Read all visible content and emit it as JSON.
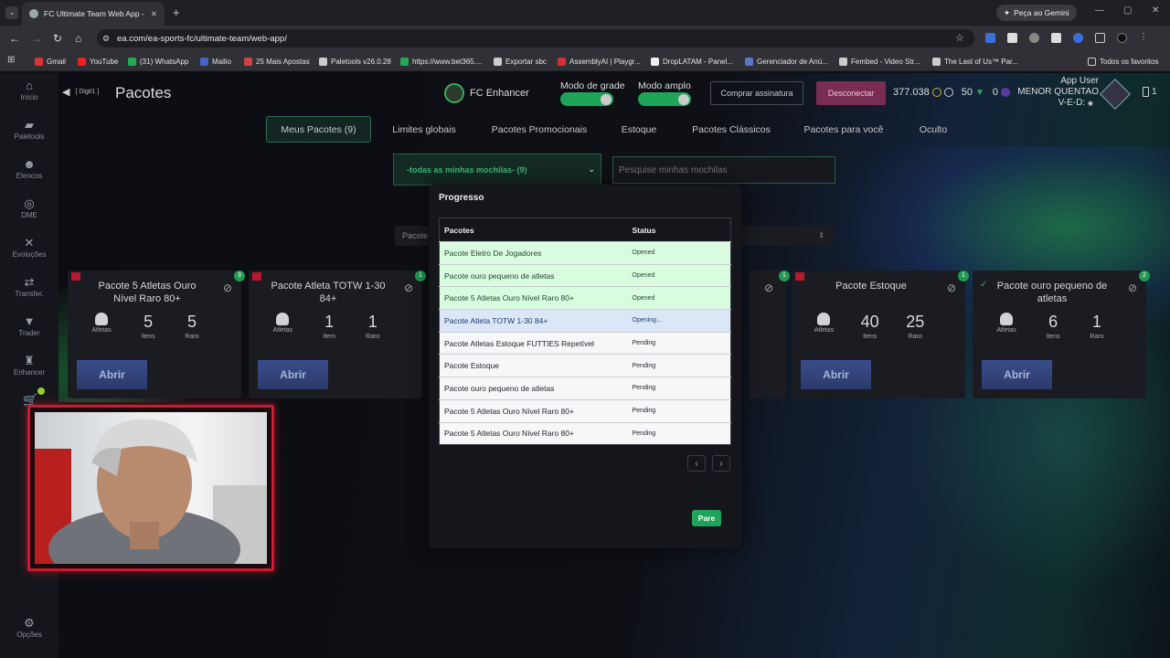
{
  "browser": {
    "tab_title": "FC Ultimate Team Web App - E...",
    "gemini_label": "Peça ao Gemini",
    "url": "ea.com/ea-sports-fc/ultimate-team/web-app/",
    "bookmarks": [
      "Gmail",
      "YouTube",
      "(31) WhatsApp",
      "Mailio",
      "25 Mais Apostas",
      "Paletools v26.0.28",
      "https://www.bet365....",
      "Exportar sbc",
      "AssemblyAI | Playgr...",
      "DropLATAM - Panel...",
      "Gerenciador de Anú...",
      "Fembed - Video Str...",
      "The Last of Us™ Par..."
    ],
    "all_favorites": "Todos os favoritos"
  },
  "sidebar": [
    "Início",
    "Paletools",
    "Elencos",
    "DME",
    "Evoluções",
    "Transfer.",
    "Trader",
    "Enhancer",
    "Opções"
  ],
  "header": {
    "back_label": "[ Digit1 ]",
    "title": "Pacotes",
    "enhancer": "FC Enhancer",
    "grid_mode": "Modo de grade",
    "wide_mode": "Modo amplo",
    "buy_subscription": "Comprar assinatura",
    "disconnect": "Desconectar",
    "coins": "377.038",
    "points": "50",
    "other": "0",
    "user_app": "App User",
    "user_name": "MENOR QUENTAO",
    "user_ved": "V-E-D:",
    "notifications": "1"
  },
  "tabs": [
    "Meus Pacotes (9)",
    "Limites globais",
    "Pacotes Promocionais",
    "Estoque",
    "Pacotes Clássicos",
    "Pacotes para você",
    "Oculto"
  ],
  "filter": {
    "select_value": "-todas as minhas mochilas- (9)",
    "search_placeholder": "Pesquise minhas mochilas",
    "sort_label": "Pacote"
  },
  "cards": [
    {
      "title": "Pacote 5 Atletas Ouro Nível Raro 80+",
      "badge": "3",
      "atletas": "5",
      "itens": "5",
      "raro": "",
      "l1": "Atletas",
      "l2": "Itens",
      "l3": "Raro",
      "open": "Abrir"
    },
    {
      "title": "Pacote Atleta TOTW 1-30 84+",
      "badge": "1",
      "atletas": "1",
      "itens": "1",
      "raro": "",
      "l1": "Atletas",
      "l2": "Item",
      "l3": "Raro",
      "open": "Abrir"
    },
    {
      "title": "Pacote Estoque",
      "badge": "1",
      "atletas": "40",
      "itens": "25",
      "raro": "",
      "l1": "Atletas",
      "l2": "Itens",
      "l3": "Raro",
      "open": "Abrir"
    },
    {
      "title": "Pacote ouro pequeno de atletas",
      "badge": "2",
      "atletas": "6",
      "itens": "1",
      "raro": "",
      "l1": "Atletas",
      "l2": "Itens",
      "l3": "Raro",
      "open": "Abrir"
    }
  ],
  "modal": {
    "title": "Progresso",
    "col_pack": "Pacotes",
    "col_status": "Status",
    "rows": [
      {
        "name": "Pacote Eletro De Jogadores",
        "status": "Opened",
        "state": "opened"
      },
      {
        "name": "Pacote ouro pequeno de atletas",
        "status": "Opened",
        "state": "opened"
      },
      {
        "name": "Pacote 5 Atletas Ouro Nível Raro 80+",
        "status": "Opened",
        "state": "opened"
      },
      {
        "name": "Pacote Atleta TOTW 1-30 84+",
        "status": "Opening...",
        "state": "opening"
      },
      {
        "name": "Pacote Atletas Estoque FUTTIES Repetível",
        "status": "Pending",
        "state": "pending"
      },
      {
        "name": "Pacote Estoque",
        "status": "Pending",
        "state": "pending"
      },
      {
        "name": "Pacote ouro pequeno de atletas",
        "status": "Pending",
        "state": "pending"
      },
      {
        "name": "Pacote 5 Atletas Ouro Nível Raro 80+",
        "status": "Pending",
        "state": "pending"
      },
      {
        "name": "Pacote 5 Atletas Ouro Nível Raro 80+",
        "status": "Pending",
        "state": "pending"
      }
    ],
    "prev": "‹",
    "next": "›",
    "stop": "Pare"
  }
}
